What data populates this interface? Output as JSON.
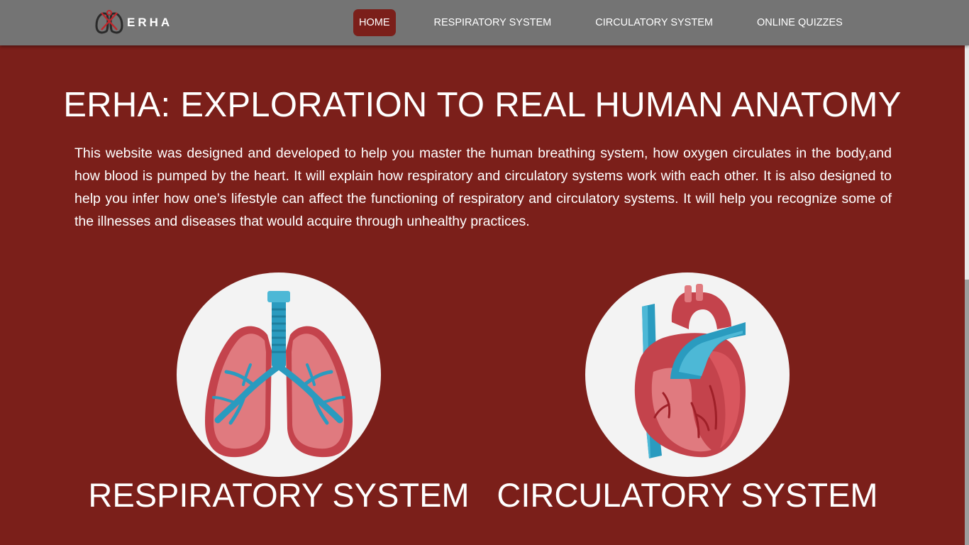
{
  "brand": {
    "name": "ERHA",
    "logo_icon": "lungs-logo-icon"
  },
  "nav": {
    "items": [
      {
        "label": "HOME",
        "active": true
      },
      {
        "label": "RESPIRATORY SYSTEM",
        "active": false
      },
      {
        "label": "CIRCULATORY SYSTEM",
        "active": false
      },
      {
        "label": "ONLINE QUIZZES",
        "active": false
      }
    ]
  },
  "hero": {
    "title": "ERHA: EXPLORATION TO REAL HUMAN ANATOMY",
    "description": "This website was designed and developed to help you master the human breathing system, how oxygen circulates in the body,and how blood is pumped by the heart. It will explain how respiratory and circulatory systems work with each other. It is also designed to help you infer how one’s lifestyle can affect the functioning of respiratory and circulatory systems. It will help you recognize some of the illnesses and diseases that would acquire through unhealthy practices."
  },
  "cards": [
    {
      "label": "RESPIRATORY SYSTEM",
      "icon": "lungs-icon"
    },
    {
      "label": "CIRCULATORY SYSTEM",
      "icon": "heart-icon"
    }
  ],
  "colors": {
    "background": "#7b1f1a",
    "navbar": "#747474",
    "active_nav": "#7b1f1a",
    "circle": "#f3f3f3"
  }
}
